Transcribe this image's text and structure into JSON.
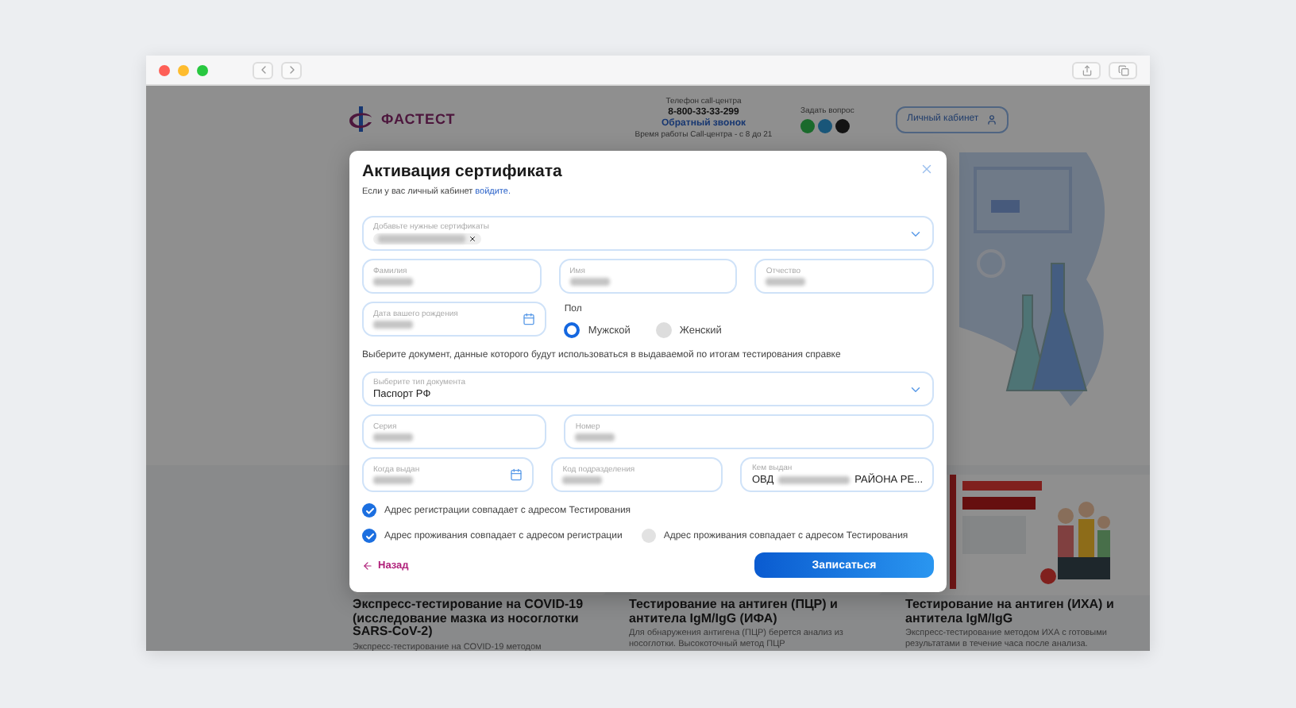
{
  "site_header": {
    "logo_text": "ФАСТЕСТ",
    "contact": {
      "label": "Телефон call-центра",
      "phone": "8-800-33-33-299",
      "callback_link": "Обратный звонок",
      "hours": "Время работы Call-центра - с 8 до 21"
    },
    "ask": {
      "label": "Задать вопрос"
    },
    "account_button": "Личный кабинет"
  },
  "cards": [
    {
      "title": "Экспресс-тестирование на COVID-19 (исследование мазка из носоглотки SARS-CoV-2)",
      "description": "Экспресс-тестирование на COVID-19 методом"
    },
    {
      "title": "Тестирование на антиген (ПЦР) и антитела IgM/IgG (ИФА)",
      "description": "Для обнаружения антигена (ПЦР) берется анализ из носоглотки. Высокоточный метод ПЦР"
    },
    {
      "title": "Тестирование на антиген (ИХА) и антитела IgM/IgG",
      "description": "Экспресс-тестирование методом ИХА с готовыми результатами в течение часа после анализа."
    }
  ],
  "modal": {
    "title": "Активация сертификата",
    "hint_text": "Если у вас личный кабинет",
    "hint_link": "войдите.",
    "certificates": {
      "label": "Добавьте нужные сертификаты",
      "chips": [
        {
          "value_hidden": true
        }
      ]
    },
    "name_fields": [
      {
        "label": "Фамилия",
        "value_hidden": true
      },
      {
        "label": "Имя",
        "value_hidden": true
      },
      {
        "label": "Отчество",
        "value_hidden": true
      }
    ],
    "birth_date": {
      "label": "Дата вашего рождения",
      "value_hidden": true
    },
    "gender": {
      "label": "Пол",
      "options": [
        {
          "label": "Мужской",
          "selected": true
        },
        {
          "label": "Женский",
          "selected": false
        }
      ]
    },
    "document_hint": "Выберите документ, данные которого будут использоваться в выдаваемой по итогам тестирования справке",
    "document_type": {
      "label": "Выберите тип документа",
      "value": "Паспорт РФ"
    },
    "passport_rows": [
      [
        {
          "kind": "text",
          "label": "Серия",
          "value_hidden": true
        },
        {
          "kind": "text",
          "label": "Номер",
          "value_hidden": true
        }
      ],
      [
        {
          "kind": "date",
          "label": "Когда выдан",
          "value_hidden": true
        },
        {
          "kind": "text",
          "label": "Код подразделения",
          "value_hidden": true
        },
        {
          "kind": "text",
          "label": "Кем выдан",
          "value_hidden": true,
          "value_parts": [
            "ОВД",
            "РАЙОНА РЕ..."
          ]
        }
      ]
    ],
    "checkbox_rows": [
      [
        {
          "label": "Адрес регистрации совпадает с адресом Тестирования",
          "checked": true
        }
      ],
      [
        {
          "label": "Адрес проживания совпадает с адресом регистрации",
          "checked": true
        },
        {
          "label": "Адрес проживания совпадает с адресом Тестирования",
          "checked": false
        }
      ]
    ],
    "back_link": "Назад",
    "submit_button": "Записаться"
  }
}
